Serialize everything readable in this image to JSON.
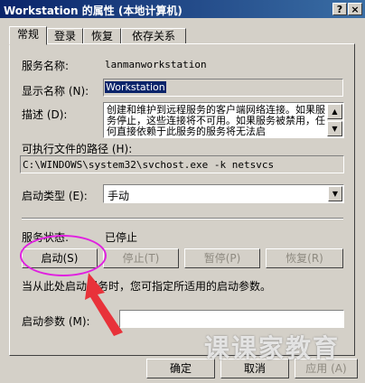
{
  "window": {
    "title": "Workstation 的属性 (本地计算机)",
    "help_button": "?",
    "close_button": "×"
  },
  "tabs": [
    {
      "label": "常规",
      "active": true
    },
    {
      "label": "登录",
      "active": false
    },
    {
      "label": "恢复",
      "active": false
    },
    {
      "label": "依存关系",
      "active": false
    }
  ],
  "general": {
    "service_name_label": "服务名称:",
    "service_name_value": "lanmanworkstation",
    "display_name_label": "显示名称 (N):",
    "display_name_value": "Workstation",
    "description_label": "描述 (D):",
    "description_text": "创建和维护到远程服务的客户端网络连接。如果服务停止，这些连接将不可用。如果服务被禁用，任何直接依赖于此服务的服务将无法启",
    "exe_path_label": "可执行文件的路径 (H):",
    "exe_path_value": "C:\\WINDOWS\\system32\\svchost.exe -k netsvcs",
    "startup_type_label": "启动类型 (E):",
    "startup_type_value": "手动",
    "status_label": "服务状态:",
    "status_value": "已停止",
    "start_button": "启动(S)",
    "stop_button": "停止(T)",
    "pause_button": "暂停(P)",
    "resume_button": "恢复(R)",
    "hint_text": "当从此处启动服务时，您可指定所适用的启动参数。",
    "start_params_label": "启动参数 (M):",
    "start_params_value": ""
  },
  "footer": {
    "ok_button": "确定",
    "cancel_button": "取消",
    "apply_button": "应用 (A)"
  },
  "watermark": "课课家教育",
  "colors": {
    "annotation_circle": "#e020e0",
    "annotation_arrow": "#e8323a",
    "title_bar": "#0a246a",
    "selection": "#0a246a"
  }
}
